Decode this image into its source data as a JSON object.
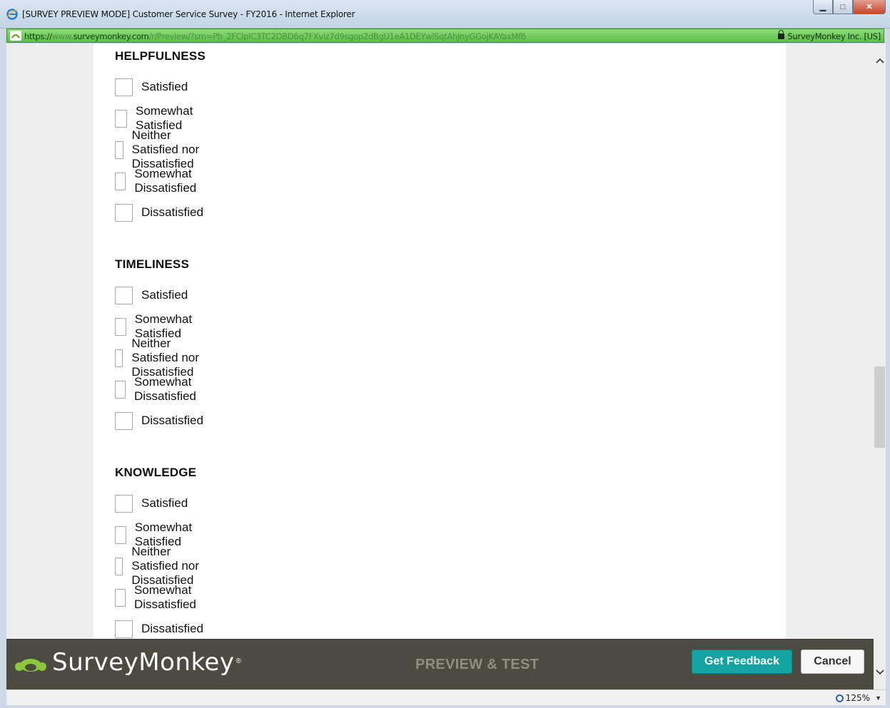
{
  "window": {
    "title": "[SURVEY PREVIEW MODE] Customer Service Survey - FY2016 - Internet Explorer",
    "minimize_glyph": "▁",
    "maximize_glyph": "□",
    "close_glyph": "✕"
  },
  "address_bar": {
    "url_proto": "https://",
    "url_sub": "www.",
    "url_domain": "surveymonkey.com",
    "url_path": "/r/Preview/?sm=Ph_2FClplC3TC2DBD6q7FXviz7d9sgop2dBgU1eA1DEYwlSqtAhJnyGGojKAYaxMf6",
    "certificate": "SurveyMonkey Inc. [US]"
  },
  "questions": [
    {
      "title": "HELPFULNESS",
      "options": [
        "Satisfied",
        "Somewhat Satisfied",
        "Neither Satisfied nor Dissatisfied",
        "Somewhat Dissatisfied",
        "Dissatisfied"
      ]
    },
    {
      "title": "TIMELINESS",
      "options": [
        "Satisfied",
        "Somewhat Satisfied",
        "Neither Satisfied nor Dissatisfied",
        "Somewhat Dissatisfied",
        "Dissatisfied"
      ]
    },
    {
      "title": "KNOWLEDGE",
      "options": [
        "Satisfied",
        "Somewhat Satisfied",
        "Neither Satisfied nor Dissatisfied",
        "Somewhat Dissatisfied",
        "Dissatisfied"
      ]
    }
  ],
  "footer": {
    "brand": "SurveyMonkey",
    "brand_mark": "®",
    "mode_label": "PREVIEW & TEST",
    "feedback_button": "Get Feedback",
    "cancel_button": "Cancel"
  },
  "status_bar": {
    "zoom": "125%",
    "zoom_arrow": "▼"
  },
  "colors": {
    "address_bar_secure": "#5cbf48",
    "feedback_button": "#14a3a3",
    "footer_bar": "#4b4b42",
    "brand_logo": "#8dc63f"
  },
  "icons": {
    "browser": "internet-explorer-icon",
    "site": "surveymonkey-favicon-icon",
    "lock": "lock-icon",
    "logo": "surveymonkey-logo-icon",
    "zoom": "magnifier-icon"
  }
}
